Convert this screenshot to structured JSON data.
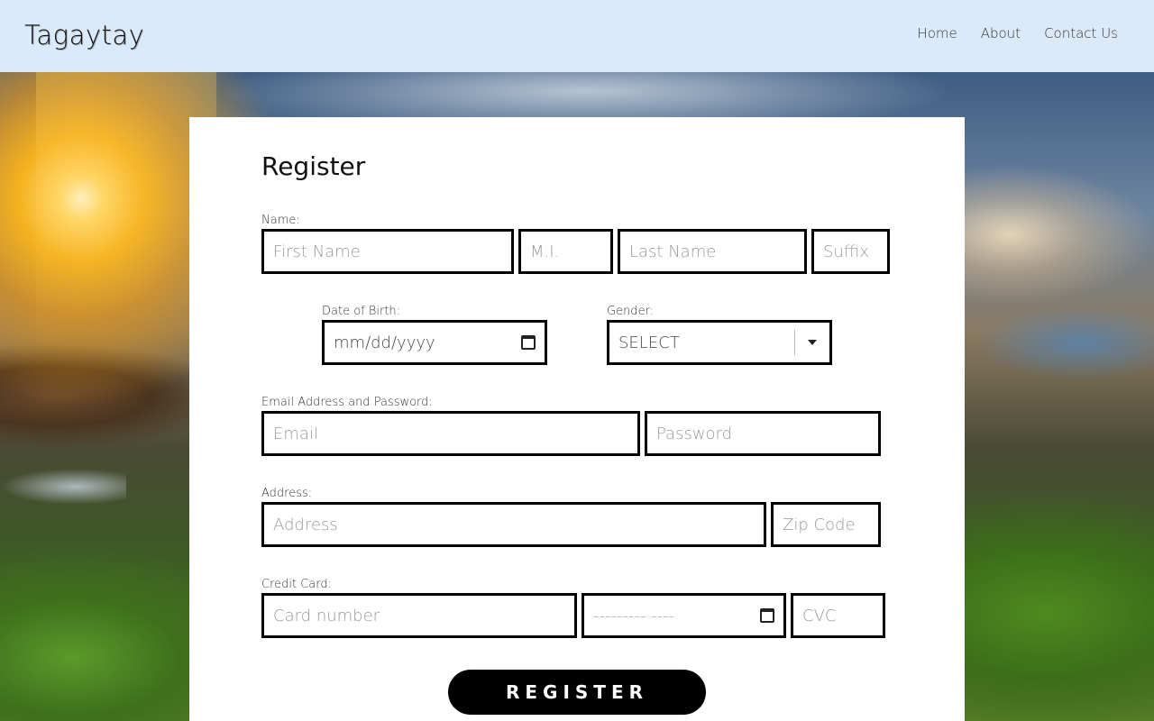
{
  "header": {
    "logo": "Tagaytay",
    "nav": [
      "Home",
      "About",
      "Contact Us"
    ]
  },
  "form": {
    "title": "Register",
    "name_label": "Name:",
    "first_name_placeholder": "First Name",
    "mi_placeholder": "M.I.",
    "last_name_placeholder": "Last Name",
    "suffix_placeholder": "Suffix",
    "dob_label": "Date of Birth:",
    "dob_value": "mm/dd/yyyy",
    "gender_label": "Gender:",
    "gender_selected": "SELECT",
    "email_pw_label": "Email Address and Password:",
    "email_placeholder": "Email",
    "password_placeholder": "Password",
    "address_label": "Address:",
    "address_placeholder": "Address",
    "zip_placeholder": "Zip Code",
    "card_label": "Credit Card:",
    "card_placeholder": "Card number",
    "expiry_value": "--------- ----",
    "cvc_placeholder": "CVC",
    "submit_label": "REGISTER"
  },
  "colors": {
    "header_bg": "#dbeafa",
    "button_bg": "#000000",
    "button_text": "#ffffff",
    "input_border": "#000000"
  },
  "icons": {
    "calendar": "calendar-icon",
    "dropdown": "chevron-down-icon"
  }
}
